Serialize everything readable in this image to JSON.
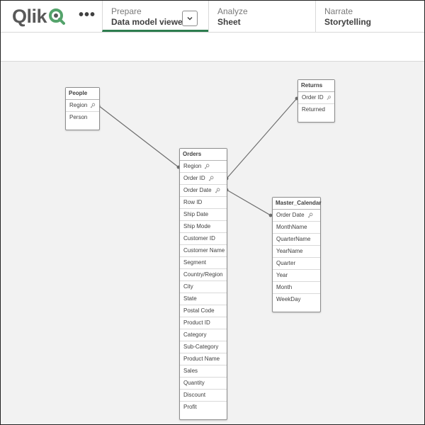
{
  "brand": {
    "logo_text": "Qlik",
    "accent_color": "#2e7d4f"
  },
  "header": {
    "more_label": "•••",
    "sections": [
      {
        "title": "Prepare",
        "sub": "Data model viewer",
        "active": true
      },
      {
        "title": "Analyze",
        "sub": "Sheet",
        "active": false
      },
      {
        "title": "Narrate",
        "sub": "Storytelling",
        "active": false
      }
    ],
    "dropdown_icon": "chevron-down-icon"
  },
  "tables": {
    "people": {
      "name": "People",
      "fields": [
        "Region",
        "Person"
      ],
      "key_fields": [
        "Region"
      ]
    },
    "returns": {
      "name": "Returns",
      "fields": [
        "Order ID",
        "Returned"
      ],
      "key_fields": [
        "Order ID"
      ]
    },
    "orders": {
      "name": "Orders",
      "fields": [
        "Region",
        "Order ID",
        "Order Date",
        "Row ID",
        "Ship Date",
        "Ship Mode",
        "Customer ID",
        "Customer Name",
        "Segment",
        "Country/Region",
        "City",
        "State",
        "Postal Code",
        "Product ID",
        "Category",
        "Sub-Category",
        "Product Name",
        "Sales",
        "Quantity",
        "Discount",
        "Profit"
      ],
      "key_fields": [
        "Region",
        "Order ID",
        "Order Date"
      ]
    },
    "master_calendar": {
      "name": "Master_Calendar",
      "fields": [
        "Order Date",
        "MonthName",
        "QuarterName",
        "YearName",
        "Quarter",
        "Year",
        "Month",
        "WeekDay"
      ],
      "key_fields": [
        "Order Date"
      ]
    }
  }
}
